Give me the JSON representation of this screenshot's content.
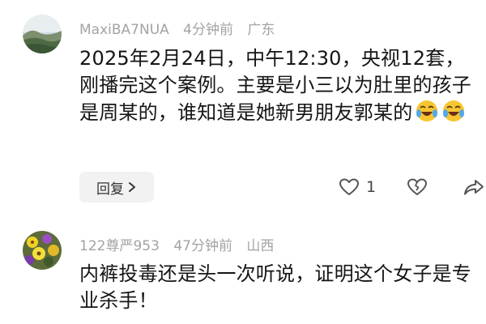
{
  "comments": [
    {
      "username": "MaxiBA7NUA",
      "time": "4分钟前",
      "location": "广东",
      "text": "2025年2月24日，中午12:30，央视12套，刚播完这个案例。主要是小三以为肚里的孩子是周某的，谁知道是她新男朋友郭某的",
      "emojis": [
        "laughing-crying-emoji",
        "laughing-crying-emoji"
      ],
      "reply_label": "回复",
      "like_count": "1"
    },
    {
      "username": "122尊严953",
      "time": "47分钟前",
      "location": "山西",
      "text": "内裤投毒还是头一次听说，证明这个女子是专业杀手！"
    }
  ],
  "icons": {
    "reply_chevron": "chevron-right-icon",
    "like": "heart-icon",
    "dislike": "broken-heart-icon",
    "share": "share-arrow-icon"
  },
  "colors": {
    "meta_text": "#a3a3a3",
    "reply_button_bg": "#f2f2f2"
  }
}
